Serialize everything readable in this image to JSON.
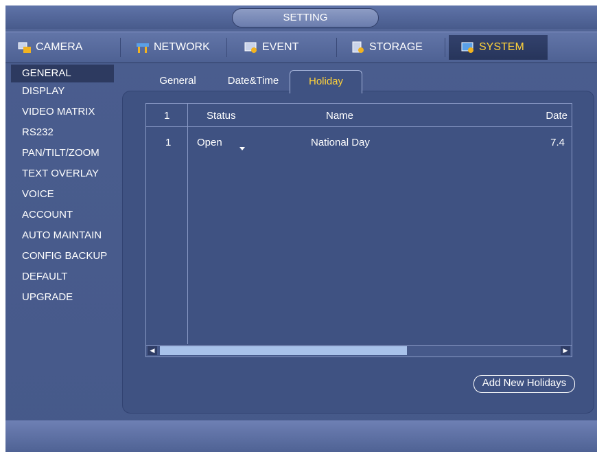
{
  "window": {
    "title": "SETTING"
  },
  "topnav": {
    "tabs": [
      {
        "label": "CAMERA",
        "icon": "camera-icon"
      },
      {
        "label": "NETWORK",
        "icon": "network-icon"
      },
      {
        "label": "EVENT",
        "icon": "event-icon"
      },
      {
        "label": "STORAGE",
        "icon": "storage-icon"
      },
      {
        "label": "SYSTEM",
        "icon": "system-icon",
        "active": true
      }
    ]
  },
  "sidebar": {
    "items": [
      {
        "label": "GENERAL",
        "active": true
      },
      {
        "label": "DISPLAY"
      },
      {
        "label": "VIDEO MATRIX"
      },
      {
        "label": "RS232"
      },
      {
        "label": "PAN/TILT/ZOOM"
      },
      {
        "label": "TEXT OVERLAY"
      },
      {
        "label": "VOICE"
      },
      {
        "label": "ACCOUNT"
      },
      {
        "label": "AUTO MAINTAIN"
      },
      {
        "label": "CONFIG BACKUP"
      },
      {
        "label": "DEFAULT"
      },
      {
        "label": "UPGRADE"
      }
    ]
  },
  "subtabs": [
    {
      "label": "General"
    },
    {
      "label": "Date&Time"
    },
    {
      "label": "Holiday",
      "active": true
    }
  ],
  "table": {
    "headers": {
      "index": "1",
      "status": "Status",
      "name": "Name",
      "date": "Date"
    },
    "rows": [
      {
        "index": "1",
        "status": "Open",
        "name": "National Day",
        "date": "7.4"
      }
    ]
  },
  "actions": {
    "add_label": "Add New Holidays"
  },
  "colors": {
    "accent": "#ffd23a",
    "background": "#46598a",
    "panel": "#3f5282"
  }
}
